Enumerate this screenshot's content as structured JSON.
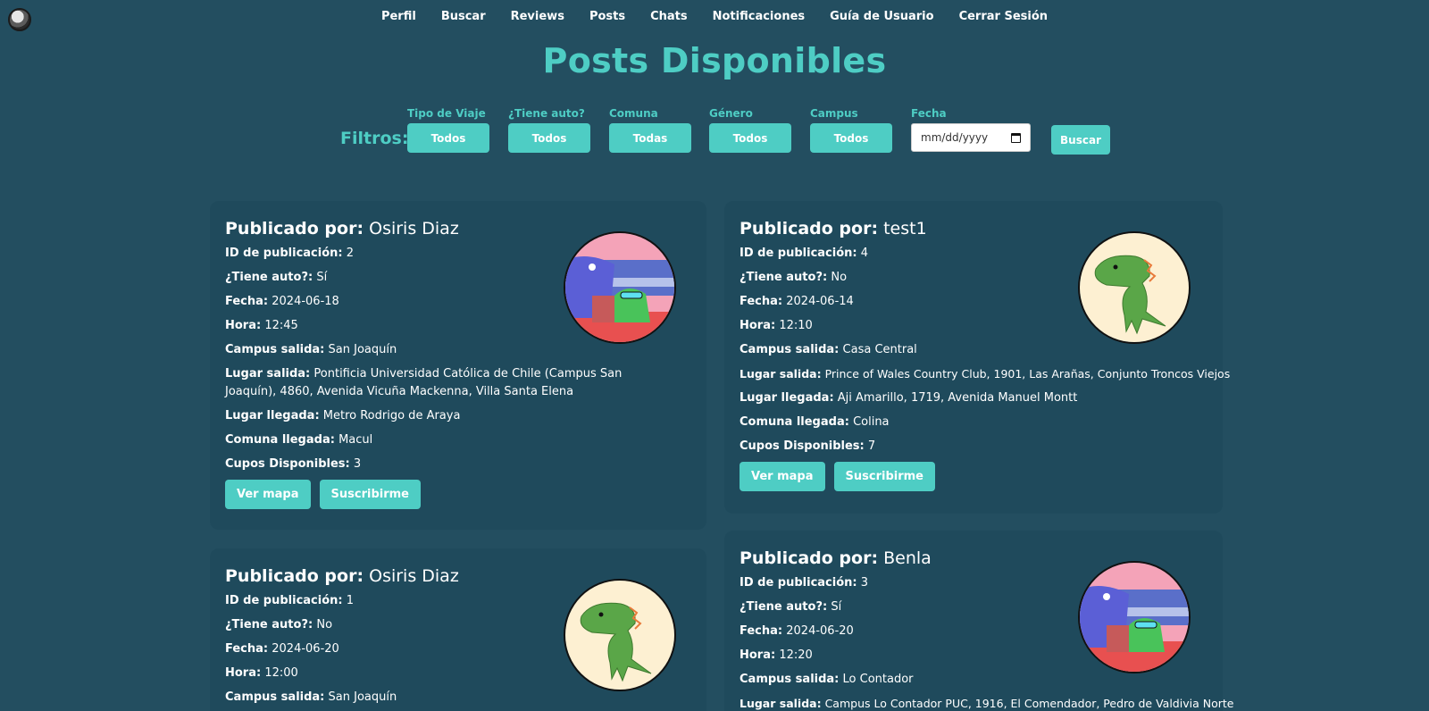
{
  "nav": [
    "Perfil",
    "Buscar",
    "Reviews",
    "Posts",
    "Chats",
    "Notificaciones",
    "Guía de Usuario",
    "Cerrar Sesión"
  ],
  "page_title": "Posts Disponibles",
  "filters": {
    "label": "Filtros:",
    "items": [
      {
        "label": "Tipo de Viaje",
        "value": "Todos"
      },
      {
        "label": "¿Tiene auto?",
        "value": "Todos"
      },
      {
        "label": "Comuna",
        "value": "Todas"
      },
      {
        "label": "Género",
        "value": "Todos"
      },
      {
        "label": "Campus",
        "value": "Todos"
      }
    ],
    "date_label": "Fecha",
    "date_placeholder": "mm/dd/yyyy",
    "search": "Buscar"
  },
  "labels": {
    "published_by": "Publicado por:",
    "id": "ID de publicación:",
    "has_car": "¿Tiene auto?:",
    "date": "Fecha:",
    "time": "Hora:",
    "campus": "Campus salida:",
    "departure": "Lugar salida:",
    "arrival": "Lugar llegada:",
    "commune": "Comuna llegada:",
    "seats": "Cupos Disponibles:",
    "map": "Ver mapa",
    "subscribe": "Suscribirme"
  },
  "posts": [
    {
      "author": "Osiris Diaz",
      "id": "2",
      "has_car": "Sí",
      "date": "2024-06-18",
      "time": "12:45",
      "campus": "San Joaquín",
      "departure": "Pontificia Universidad Católica de Chile (Campus San Joaquín), 4860, Avenida Vicuña Mackenna, Villa Santa Elena",
      "arrival": "Metro Rodrigo de Araya",
      "commune": "Macul",
      "seats": "3",
      "avatar": "dino-car-icon"
    },
    {
      "author": "test1",
      "id": "4",
      "has_car": "No",
      "date": "2024-06-14",
      "time": "12:10",
      "campus": "Casa Central",
      "departure": "Prince of Wales Country Club, 1901, Las Arañas, Conjunto Troncos Viejos",
      "arrival": "Aji Amarillo, 1719, Avenida Manuel Montt",
      "commune": "Colina",
      "seats": "7",
      "avatar": "green-dino-icon"
    },
    {
      "author": "Osiris Diaz",
      "id": "1",
      "has_car": "No",
      "date": "2024-06-20",
      "time": "12:00",
      "campus": "San Joaquín",
      "avatar": "green-dino-icon"
    },
    {
      "author": "Benla",
      "id": "3",
      "has_car": "Sí",
      "date": "2024-06-20",
      "time": "12:20",
      "campus": "Lo Contador",
      "departure": "Campus Lo Contador PUC, 1916, El Comendador, Pedro de Valdivia Norte",
      "avatar": "dino-car-icon"
    }
  ]
}
